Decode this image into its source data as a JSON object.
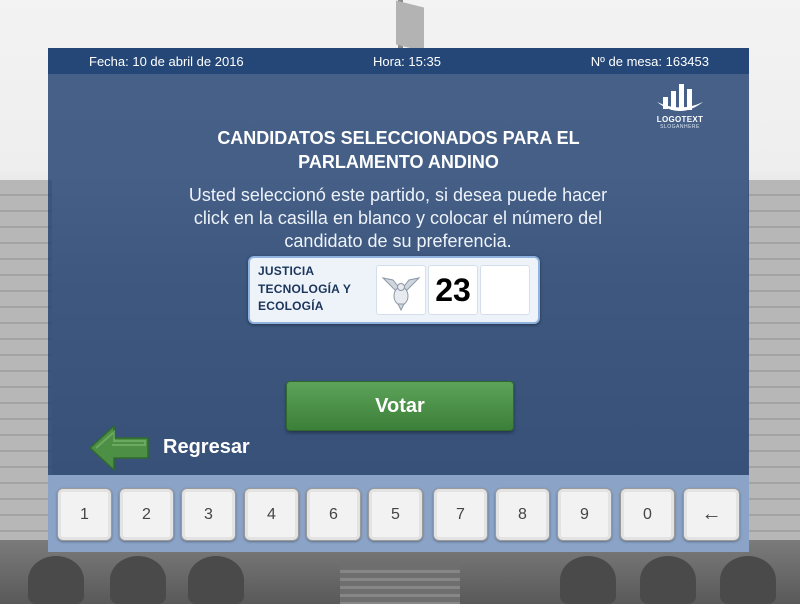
{
  "header": {
    "date": "Fecha: 10 de abril de 2016",
    "time": "Hora: 15:35",
    "table": "Nº de mesa: 163453"
  },
  "logo": {
    "text": "LOGOTEXT",
    "slogan": "SLOGANHERE"
  },
  "main": {
    "title_line1": "CANDIDATOS SELECCIONADOS PARA EL",
    "title_line2": "PARLAMENTO ANDINO",
    "instructions_line1": "Usted seleccionó este partido, si desea puede hacer",
    "instructions_line2": "click en la casilla en blanco y colocar el número del",
    "instructions_line3": "candidato de su preferencia."
  },
  "party": {
    "name_line1": "JUSTICIA",
    "name_line2": "TECNOLOGÍA Y",
    "name_line3": "ECOLOGÍA",
    "logo_icon": "dove-icon",
    "candidate1": "23",
    "candidate2": ""
  },
  "actions": {
    "vote_label": "Votar",
    "back_label": "Regresar"
  },
  "keypad": {
    "keys": [
      "1",
      "2",
      "3",
      "4",
      "6",
      "5",
      "7",
      "8",
      "9",
      "0",
      "←"
    ]
  },
  "colors": {
    "panel": "#204070",
    "header_bar": "#244777",
    "vote_button": "#4a8f46",
    "back_arrow": "#4e8f46",
    "keypad_bar": "#8aa3c6"
  }
}
